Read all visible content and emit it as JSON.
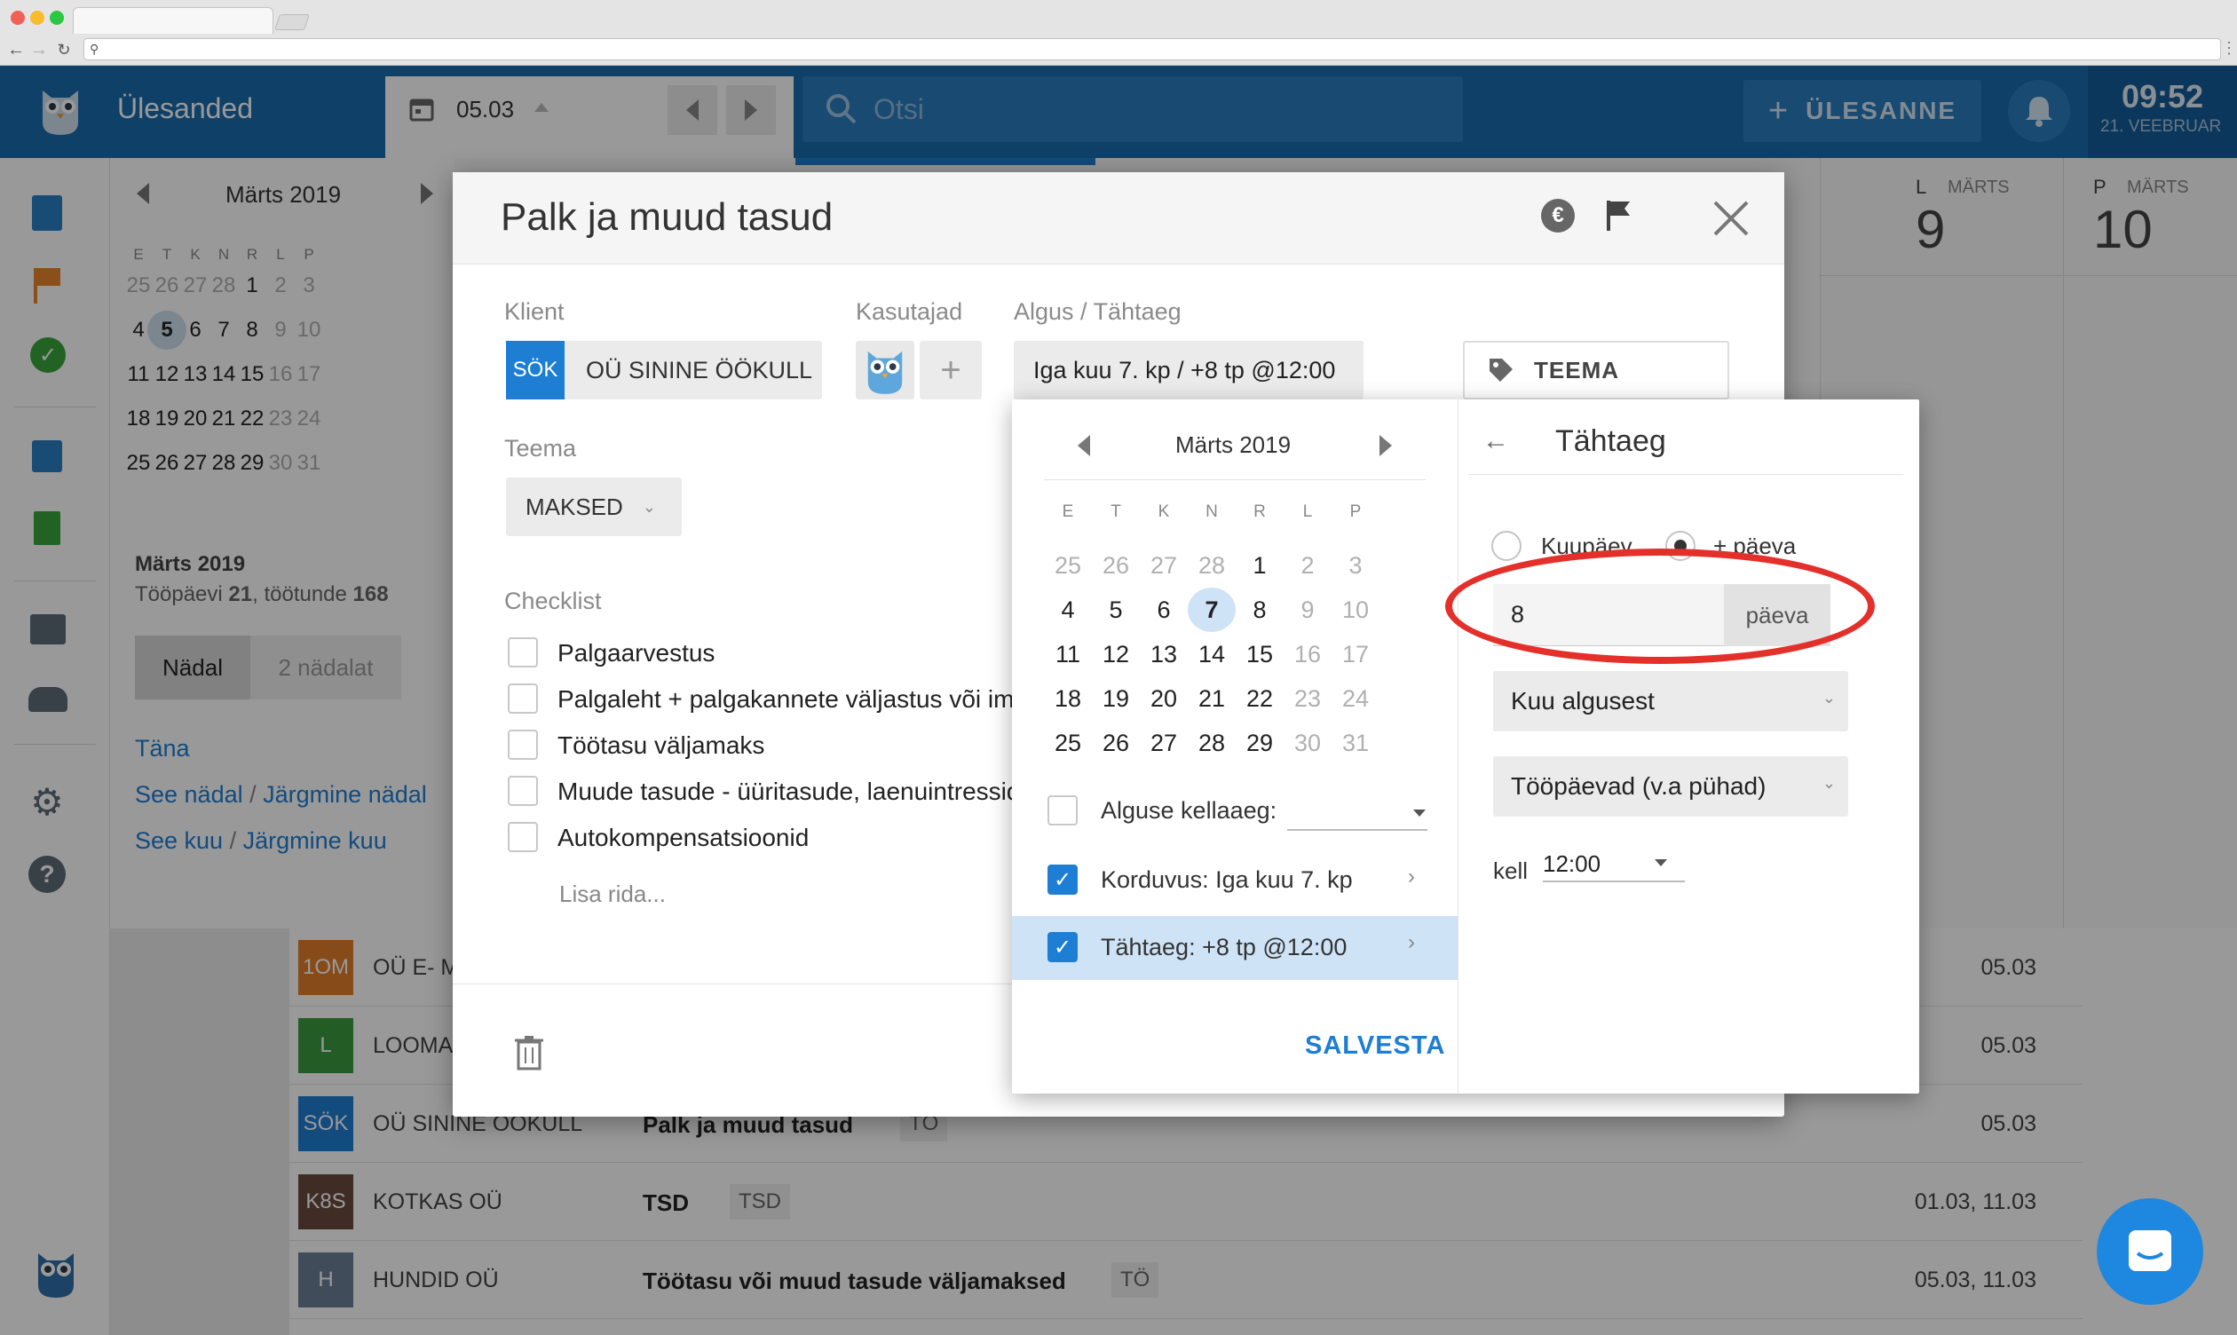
{
  "browser": {
    "url": ""
  },
  "app": {
    "title": "Ülesanded",
    "date": "05.03",
    "search_placeholder": "Otsi",
    "add_task": "ÜLESANNE",
    "time": "09:52",
    "date_long": "21. VEEBRUAR"
  },
  "colors": {
    "header": "#196bad",
    "accent": "#1e7ed3",
    "highlight": "#e4302a"
  },
  "mini_calendar": {
    "title": "Märts 2019",
    "weekdays": [
      "E",
      "T",
      "K",
      "N",
      "R",
      "L",
      "P"
    ],
    "weeks": [
      [
        "25",
        "26",
        "27",
        "28",
        "1",
        "2",
        "3"
      ],
      [
        "4",
        "5",
        "6",
        "7",
        "8",
        "9",
        "10"
      ],
      [
        "11",
        "12",
        "13",
        "14",
        "15",
        "16",
        "17"
      ],
      [
        "18",
        "19",
        "20",
        "21",
        "22",
        "23",
        "24"
      ],
      [
        "25",
        "26",
        "27",
        "28",
        "29",
        "30",
        "31"
      ]
    ],
    "today": "5"
  },
  "month_summary": {
    "title": "Märts 2019",
    "workdays_label": "Tööpäevi",
    "workdays": "21",
    "hours_label": "töötunde",
    "hours": "168"
  },
  "view_toggle": {
    "week": "Nädal",
    "two_weeks": "2 nädalat"
  },
  "quick_links": {
    "today": "Täna",
    "this_week": "See nädal",
    "next_week": "Järgmine nädal",
    "this_month": "See kuu",
    "next_month": "Järgmine kuu",
    "sep": "/"
  },
  "day_columns": [
    {
      "dow": "L",
      "month": "MÄRTS",
      "day": "9"
    },
    {
      "dow": "P",
      "month": "MÄRTS",
      "day": "10"
    }
  ],
  "task_rows": [
    {
      "badge": "1OM",
      "badge_color": "#e27d2b",
      "client": "OÜ E- M",
      "task": "",
      "tag": "",
      "dates": "05.03"
    },
    {
      "badge": "L",
      "badge_color": "#3d9a40",
      "client": "LOOMA",
      "task": "",
      "tag": "",
      "dates": "05.03"
    },
    {
      "badge": "SÖK",
      "badge_color": "#1e7ed3",
      "client": "OÜ SININE ÖÖKULL",
      "task": "Palk ja muud tasud",
      "tag": "TÖ",
      "dates": "05.03"
    },
    {
      "badge": "K8S",
      "badge_color": "#6a4b3e",
      "client": "KOTKAS OÜ",
      "task": "TSD",
      "tag": "TSD",
      "dates": "01.03, 11.03"
    },
    {
      "badge": "H",
      "badge_color": "#6b7f96",
      "client": "HUNDID OÜ",
      "task": "Töötasu või muud tasude väljamaksed",
      "tag": "TÖ",
      "dates": "05.03, 11.03"
    }
  ],
  "modal": {
    "title": "Palk ja muud tasud",
    "client_label": "Klient",
    "client_badge": "SÖK",
    "client_name": "OÜ SININE ÖÖKULL",
    "users_label": "Kasutajad",
    "start_label": "Algus / Tähtaeg",
    "start_value": "Iga kuu 7. kp / +8 tp @12:00",
    "theme_button": "TEEMA",
    "teema_label": "Teema",
    "teema_value": "MAKSED",
    "checklist_label": "Checklist",
    "checklist": [
      "Palgaarvestus",
      "Palgaleht + palgakannete väljastus või imp",
      "Töötasu väljamaks",
      "Muude tasude - üüritasude, laenuintressid",
      "Autokompensatsioonid"
    ],
    "add_row": "Lisa rida..."
  },
  "popover": {
    "cal_title": "Märts 2019",
    "weekdays": [
      "E",
      "T",
      "K",
      "N",
      "R",
      "L",
      "P"
    ],
    "weeks": [
      [
        "25",
        "26",
        "27",
        "28",
        "1",
        "2",
        "3"
      ],
      [
        "4",
        "5",
        "6",
        "7",
        "8",
        "9",
        "10"
      ],
      [
        "11",
        "12",
        "13",
        "14",
        "15",
        "16",
        "17"
      ],
      [
        "18",
        "19",
        "20",
        "21",
        "22",
        "23",
        "24"
      ],
      [
        "25",
        "26",
        "27",
        "28",
        "29",
        "30",
        "31"
      ]
    ],
    "selected": "7",
    "start_time_label": "Alguse kellaaeg:",
    "recurrence": "Korduvus: Iga kuu 7. kp",
    "deadline": "Tähtaeg: +8 tp @12:00",
    "save": "SALVESTA",
    "deadline_title": "Tähtaeg",
    "radio_date": "Kuupäev",
    "radio_days": "+ päeva",
    "days_value": "8",
    "days_unit": "päeva",
    "from_select": "Kuu algusest",
    "daytype_select": "Tööpäevad (v.a pühad)",
    "time_label": "kell",
    "time_value": "12:00"
  }
}
